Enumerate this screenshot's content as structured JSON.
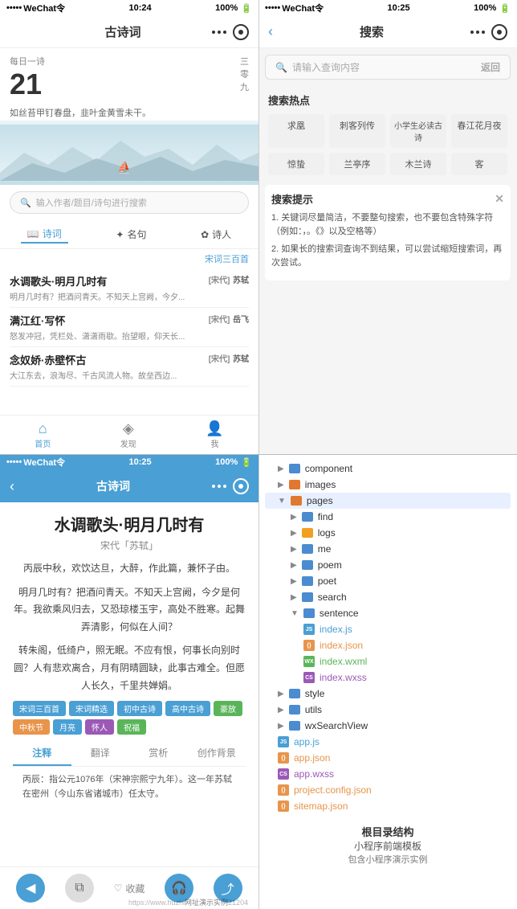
{
  "left_top": {
    "status": {
      "signal": "•••••",
      "carrier": "WeChat令",
      "time": "10:24",
      "battery": "100%"
    },
    "nav": {
      "title": "古诗词",
      "dots_label": "···",
      "target_label": "⊙"
    },
    "daily": {
      "label": "每日一诗",
      "date_num": "21",
      "date_side1": "三",
      "date_side2": "零",
      "date_side3": "九",
      "poem_line": "如丝苔甲钉春盘，韭叶金黄雪未干。"
    },
    "search_placeholder": "输入作者/题目/诗句进行搜索",
    "tabs": [
      "诗词",
      "名句",
      "诗人"
    ],
    "filter": "宋词三百首",
    "poems": [
      {
        "title": "水调歌头·明月几时有",
        "dynasty": "[宋代]",
        "author": "苏轼",
        "excerpt": "明月几时有？把酒问青天。不知天上宫阙，今夕..."
      },
      {
        "title": "满江红·写怀",
        "dynasty": "[宋代]",
        "author": "岳飞",
        "excerpt": "怒发冲冠，凭栏处、潇潇雨歇。抬望眼，仰天长..."
      },
      {
        "title": "念奴娇·赤壁怀古",
        "dynasty": "[宋代]",
        "author": "苏轼",
        "excerpt": "大江东去，浪淘尽、千古风流人物。故垒西边..."
      }
    ],
    "bottom_nav": [
      "首页",
      "发现",
      "我"
    ]
  },
  "right_top": {
    "status": {
      "signal": "•••••",
      "carrier": "WeChat令",
      "time": "10:25",
      "battery": "100%"
    },
    "nav": {
      "back": "‹",
      "title": "搜索",
      "dots_label": "···",
      "target_label": "⊙"
    },
    "search_placeholder": "请输入查询内容",
    "return_btn": "返回",
    "hot_section": "搜索热点",
    "hot_tags": [
      "求凰",
      "刺客列传",
      "小学生必读古诗",
      "春江花月夜",
      "惊蛰",
      "兰亭序",
      "木兰诗",
      "客"
    ],
    "tip_section": "搜索提示",
    "tips": [
      "1. 关键词尽量简洁，不要整句搜索，也不要包含特殊字符（例如：，。《》以及空格等）",
      "2. 如果长的搜索词查询不到结果，可以尝试缩短搜索词，再次尝试。"
    ]
  },
  "bottom_left": {
    "status": {
      "signal": "•••••",
      "carrier": "WeChat令",
      "time": "10:25",
      "battery": "100%"
    },
    "nav": {
      "back": "‹",
      "title": "古诗词",
      "dots_label": "···",
      "target_label": "⊙"
    },
    "poem": {
      "title": "水调歌头·明月几时有",
      "author": "宋代「苏轼」",
      "stanza1": "丙辰中秋，欢饮达旦，大醉，作此篇，兼怀子由。",
      "stanza2": "明月几时有？把酒问青天。不知天上宫阙，今夕是何年。我欲乘风归去，又恐琼楼玉宇，高处不胜寒。起舞弄清影，何似在人间？",
      "stanza3": "转朱阁，低绮户，照无眠。不应有恨，何事长向别时圆？人有悲欢离合，月有阴晴圆缺，此事古难全。但愿人长久，千里共婵娟。"
    },
    "tags": [
      "宋词三百首",
      "宋词精选",
      "初中古诗",
      "高中古诗",
      "豪放",
      "中秋节",
      "月亮",
      "怀人",
      "祝福"
    ],
    "annotation_tabs": [
      "注释",
      "翻译",
      "赏析",
      "创作背景"
    ],
    "annotation_text": "丙辰：指公元1076年（宋神宗熙宁九年）。这一年苏轼在密州（今山东省诸城市）任太守。",
    "collect": "收藏"
  },
  "bottom_right": {
    "files": [
      {
        "indent": 1,
        "type": "folder",
        "name": "component",
        "color": "blue",
        "open": false
      },
      {
        "indent": 1,
        "type": "folder",
        "name": "images",
        "color": "orange",
        "open": false
      },
      {
        "indent": 1,
        "type": "folder",
        "name": "pages",
        "color": "orange",
        "open": true,
        "active": true
      },
      {
        "indent": 2,
        "type": "folder",
        "name": "find",
        "color": "blue",
        "open": false
      },
      {
        "indent": 2,
        "type": "folder",
        "name": "logs",
        "color": "yellow",
        "open": false
      },
      {
        "indent": 2,
        "type": "folder",
        "name": "me",
        "color": "blue",
        "open": false
      },
      {
        "indent": 2,
        "type": "folder",
        "name": "poem",
        "color": "blue",
        "open": false
      },
      {
        "indent": 2,
        "type": "folder",
        "name": "poet",
        "color": "blue",
        "open": false
      },
      {
        "indent": 2,
        "type": "folder",
        "name": "search",
        "color": "blue",
        "open": false
      },
      {
        "indent": 2,
        "type": "folder",
        "name": "sentence",
        "color": "blue",
        "open": false
      },
      {
        "indent": 3,
        "type": "file",
        "name": "index.js",
        "ext": "js"
      },
      {
        "indent": 3,
        "type": "file",
        "name": "index.json",
        "ext": "json"
      },
      {
        "indent": 3,
        "type": "file",
        "name": "index.wxml",
        "ext": "wxml"
      },
      {
        "indent": 3,
        "type": "file",
        "name": "index.wxss",
        "ext": "wxss"
      },
      {
        "indent": 1,
        "type": "folder",
        "name": "style",
        "color": "blue",
        "open": false
      },
      {
        "indent": 1,
        "type": "folder",
        "name": "utils",
        "color": "blue",
        "open": false
      },
      {
        "indent": 1,
        "type": "folder",
        "name": "wxSearchView",
        "color": "blue",
        "open": false
      },
      {
        "indent": 1,
        "type": "file",
        "name": "app.js",
        "ext": "js"
      },
      {
        "indent": 1,
        "type": "file",
        "name": "app.json",
        "ext": "json"
      },
      {
        "indent": 1,
        "type": "file",
        "name": "app.wxss",
        "ext": "wxss"
      },
      {
        "indent": 1,
        "type": "file",
        "name": "project.config.json",
        "ext": "json"
      },
      {
        "indent": 1,
        "type": "file",
        "name": "sitemap.json",
        "ext": "json"
      }
    ],
    "caption1": "根目录结构",
    "caption2": "小程序前端模板",
    "caption3": "包含小程序演示实例",
    "watermark": "https://www.huzhi"
  }
}
